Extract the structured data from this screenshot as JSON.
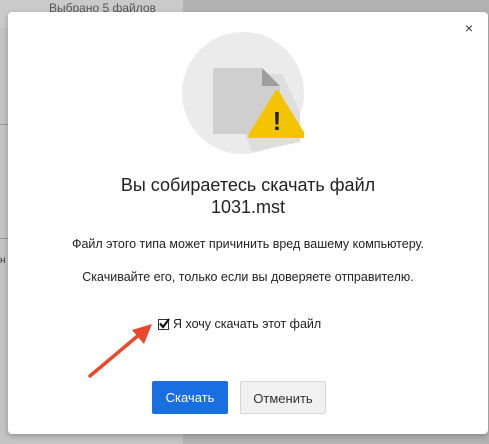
{
  "background": {
    "header_text": "Выбрано 5 файлов",
    "side_fragment": "н"
  },
  "dialog": {
    "close_glyph": "×",
    "title": "Вы собираетесь скачать файл",
    "filename": "1031.mst",
    "warning_line1": "Файл этого типа может причинить вред вашему компьютеру.",
    "warning_line2": "Скачивайте его, только если вы доверяете отправителю.",
    "consent_label": "Я хочу скачать этот файл",
    "consent_checked": true,
    "download_button": "Скачать",
    "cancel_button": "Отменить",
    "warning_glyph": "!"
  },
  "colors": {
    "primary": "#1a6fe0",
    "warning": "#f5c400",
    "annotation_arrow": "#e8482e"
  },
  "icons": [
    "file-warning-illustration",
    "close-icon",
    "checkmark-icon",
    "annotation-arrow"
  ]
}
